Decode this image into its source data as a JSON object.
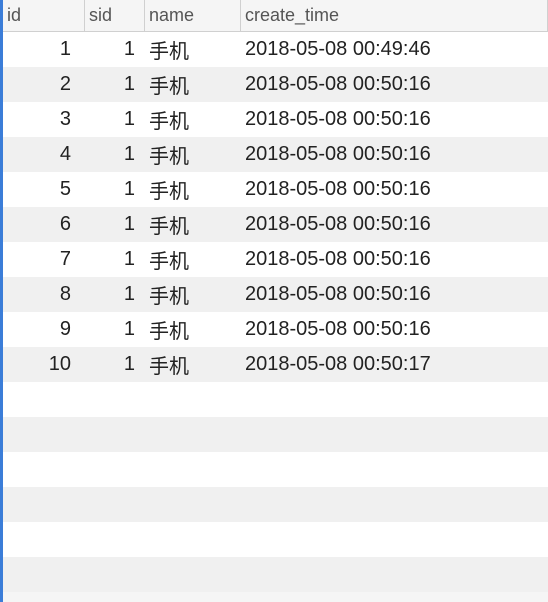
{
  "table": {
    "columns": [
      {
        "key": "id",
        "label": "id"
      },
      {
        "key": "sid",
        "label": "sid"
      },
      {
        "key": "name",
        "label": "name"
      },
      {
        "key": "create_time",
        "label": "create_time"
      }
    ],
    "rows": [
      {
        "id": "1",
        "sid": "1",
        "name": "手机",
        "create_time": "2018-05-08 00:49:46"
      },
      {
        "id": "2",
        "sid": "1",
        "name": "手机",
        "create_time": "2018-05-08 00:50:16"
      },
      {
        "id": "3",
        "sid": "1",
        "name": "手机",
        "create_time": "2018-05-08 00:50:16"
      },
      {
        "id": "4",
        "sid": "1",
        "name": "手机",
        "create_time": "2018-05-08 00:50:16"
      },
      {
        "id": "5",
        "sid": "1",
        "name": "手机",
        "create_time": "2018-05-08 00:50:16"
      },
      {
        "id": "6",
        "sid": "1",
        "name": "手机",
        "create_time": "2018-05-08 00:50:16"
      },
      {
        "id": "7",
        "sid": "1",
        "name": "手机",
        "create_time": "2018-05-08 00:50:16"
      },
      {
        "id": "8",
        "sid": "1",
        "name": "手机",
        "create_time": "2018-05-08 00:50:16"
      },
      {
        "id": "9",
        "sid": "1",
        "name": "手机",
        "create_time": "2018-05-08 00:50:16"
      },
      {
        "id": "10",
        "sid": "1",
        "name": "手机",
        "create_time": "2018-05-08 00:50:17"
      }
    ]
  }
}
